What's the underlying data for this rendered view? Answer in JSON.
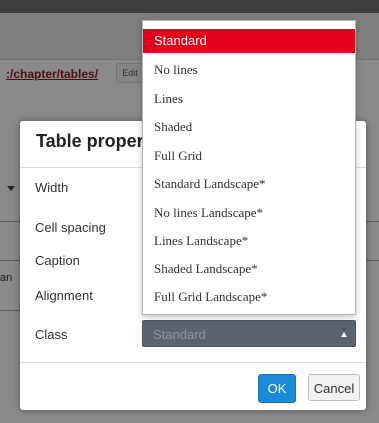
{
  "background": {
    "path_text": ":/chapter/tables/",
    "edit_label": "Edit",
    "side_text": "an"
  },
  "dialog": {
    "title": "Table proper",
    "close_icon": "close-icon",
    "labels": {
      "width": "Width",
      "cell_spacing": "Cell spacing",
      "caption": "Caption",
      "alignment": "Alignment",
      "class": "Class"
    },
    "class_value": "Standard",
    "ok_label": "OK",
    "cancel_label": "Cancel"
  },
  "dropdown": {
    "options": [
      "Standard",
      "No lines",
      "Lines",
      "Shaded",
      "Full Grid",
      "Standard Landscape*",
      "No lines Landscape*",
      "Lines Landscape*",
      "Shaded Landscape*",
      "Full Grid Landscape*"
    ],
    "selected": "Standard"
  },
  "colors": {
    "selected_option": "#e2001a",
    "ok_button": "#1a8ad6",
    "select_background": "#5b6371"
  }
}
